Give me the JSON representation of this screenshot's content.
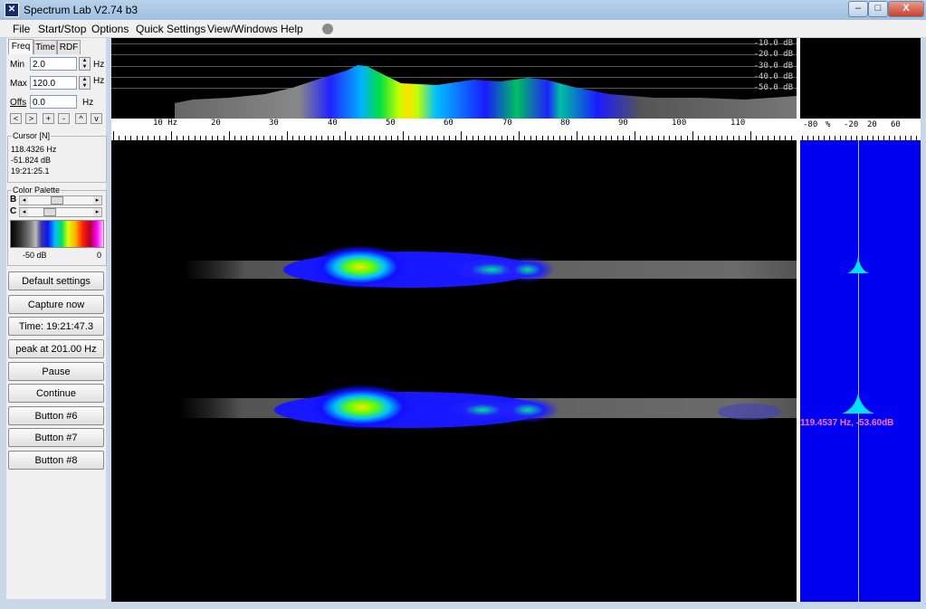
{
  "window": {
    "title": "Spectrum Lab V2.74 b3",
    "minimize": "–",
    "maximize": "□",
    "close": "X"
  },
  "menu": {
    "file": "File",
    "startstop": "Start/Stop",
    "options": "Options",
    "quick_settings": "Quick Settings",
    "view_windows": "View/Windows",
    "help": "Help"
  },
  "left": {
    "tabs": [
      "Freq",
      "Time",
      "RDF"
    ],
    "min_label": "Min",
    "min_value": "2.0",
    "max_label": "Max",
    "max_value": "120.0",
    "offs_label": "Offs",
    "offs_value": "0.0",
    "unit": "Hz",
    "small_buttons": [
      "<",
      ">",
      "+",
      "-",
      "^",
      "v"
    ],
    "cursor_title": "Cursor [N]",
    "cursor_freq": "118.4326 Hz",
    "cursor_db": "-51.824 dB",
    "cursor_time": "19:21:25.1",
    "palette_title": "Color Palette",
    "palette_b": "B",
    "palette_c": "C",
    "palette_min": "-50 dB",
    "palette_max": "0",
    "buttons": [
      "Default settings",
      "Capture now",
      "Time:  19:21:47.3",
      "peak at 201.00 Hz",
      "Pause",
      "Continue",
      "Button #6",
      "Button #7",
      "Button #8"
    ]
  },
  "spectrum": {
    "db_labels": [
      "-10.0 dB",
      "-20.0 dB",
      "-30.0 dB",
      "-40.0 dB",
      "-50.0 dB"
    ]
  },
  "axis": {
    "hz_label": "10 Hz",
    "ticks": [
      "20",
      "30",
      "40",
      "50",
      "60",
      "70",
      "80",
      "90",
      "100",
      "110"
    ],
    "right_labels": [
      "-80",
      "%",
      "-20",
      "20",
      "60"
    ]
  },
  "right_panel": {
    "peak_readout": "119.4537 Hz, -53.60dB"
  },
  "colors": {
    "waterfall_bg": "#000000",
    "right_bg": "#0000f0",
    "peak_text": "#ff70ff"
  }
}
